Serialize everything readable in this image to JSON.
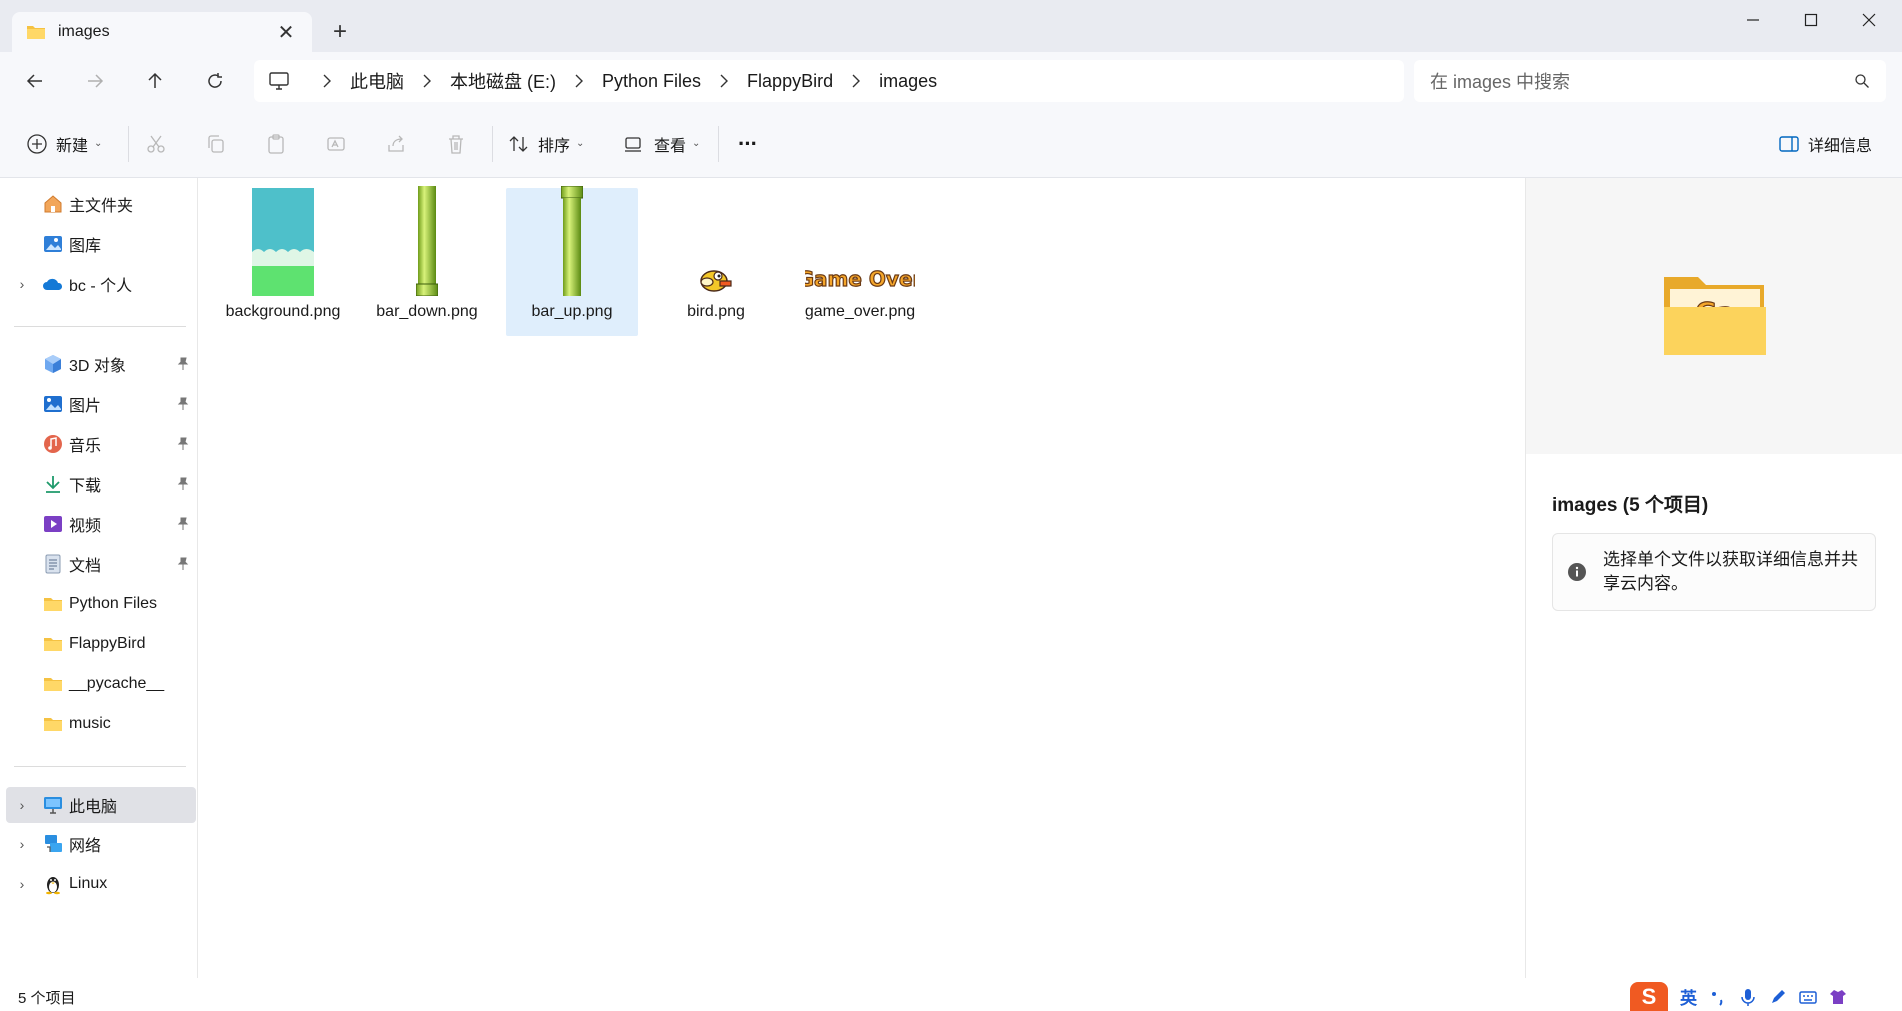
{
  "window": {
    "tab_title": "images",
    "new_tab": "+",
    "close_tab": "✕"
  },
  "address": {
    "crumbs": [
      "此电脑",
      "本地磁盘 (E:)",
      "Python Files",
      "FlappyBird",
      "images"
    ],
    "search_placeholder": "在 images 中搜索"
  },
  "toolbar": {
    "new_label": "新建",
    "sort_label": "排序",
    "view_label": "查看",
    "more_label": "···",
    "details_label": "详细信息"
  },
  "sidebar": {
    "quick": [
      {
        "label": "主文件夹",
        "icon": "home-icon"
      },
      {
        "label": "图库",
        "icon": "gallery-icon"
      },
      {
        "label": "bc - 个人",
        "icon": "onedrive-cloud-icon"
      }
    ],
    "pinned": [
      {
        "label": "3D 对象",
        "icon": "3d-objects-icon"
      },
      {
        "label": "图片",
        "icon": "pictures-icon"
      },
      {
        "label": "音乐",
        "icon": "music-icon"
      },
      {
        "label": "下载",
        "icon": "download-icon"
      },
      {
        "label": "视频",
        "icon": "videos-icon"
      },
      {
        "label": "文档",
        "icon": "documents-icon"
      },
      {
        "label": "Python Files",
        "icon": "folder-icon"
      },
      {
        "label": "FlappyBird",
        "icon": "folder-icon"
      },
      {
        "label": "__pycache__",
        "icon": "folder-icon"
      },
      {
        "label": "music",
        "icon": "folder-icon"
      }
    ],
    "devices": [
      {
        "label": "此电脑",
        "icon": "this-pc-icon"
      },
      {
        "label": "网络",
        "icon": "network-icon"
      },
      {
        "label": "Linux",
        "icon": "linux-penguin-icon"
      }
    ]
  },
  "files": [
    {
      "name": "background.png",
      "thumb": "background"
    },
    {
      "name": "bar_down.png",
      "thumb": "pipe"
    },
    {
      "name": "bar_up.png",
      "thumb": "pipe"
    },
    {
      "name": "bird.png",
      "thumb": "bird"
    },
    {
      "name": "game_over.png",
      "thumb": "gameover"
    }
  ],
  "thumb_gameover_text": "Game Over",
  "details": {
    "title": "images (5 个项目)",
    "info": "选择单个文件以获取详细信息并共享云内容。"
  },
  "status": {
    "count": "5 个项目"
  },
  "ime": {
    "logo": "S",
    "lang": "英"
  },
  "colors": {
    "accent": "#0067c0",
    "selected_bg": "#dfeefc",
    "folder_yellow": "#f5c242"
  }
}
